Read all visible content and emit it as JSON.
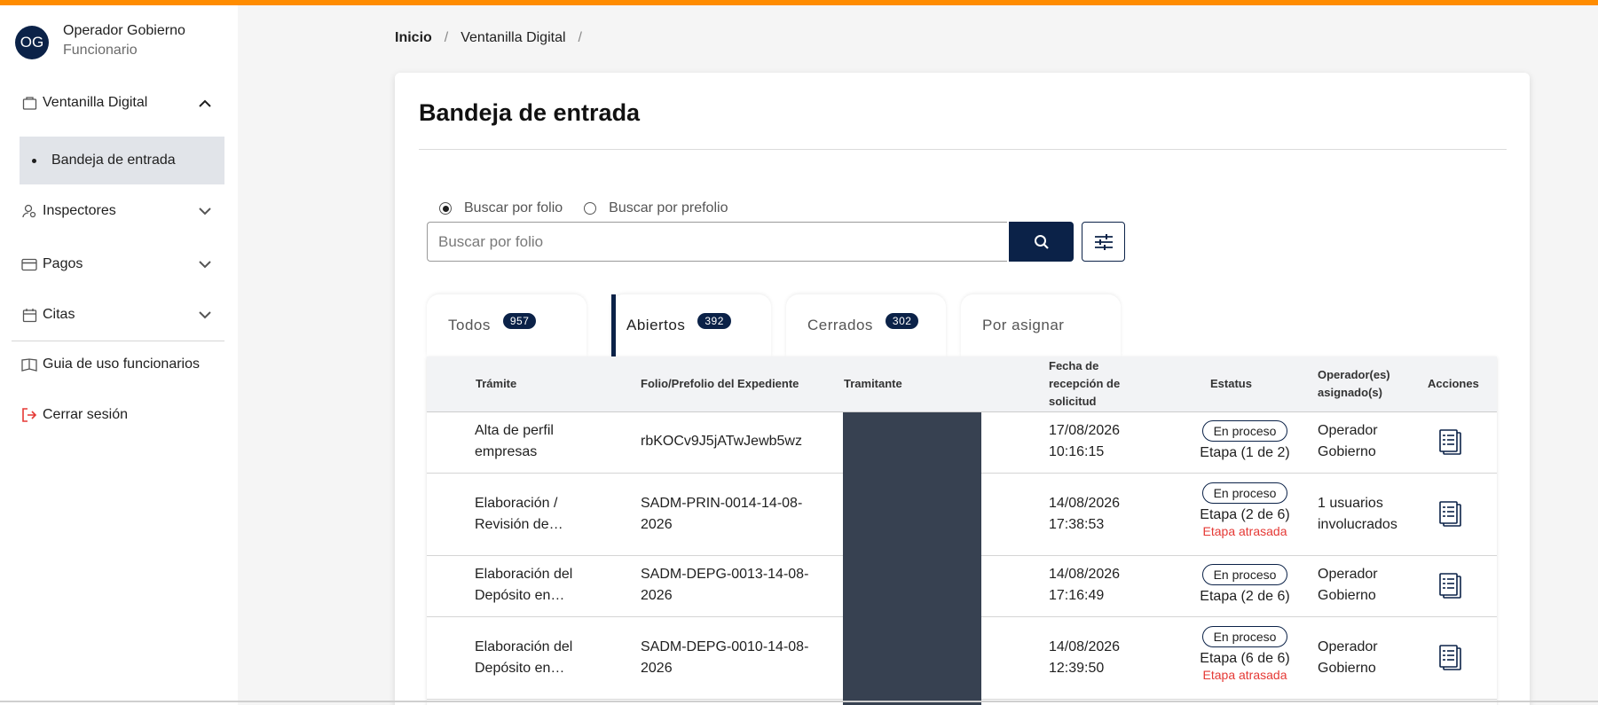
{
  "colors": {
    "accent": "#ff8c00",
    "primary": "#0b2248",
    "late": "#e53935"
  },
  "user": {
    "initials": "OG",
    "name": "Operador Gobierno",
    "role": "Funcionario"
  },
  "sidebar": {
    "items": [
      {
        "label": "Ventanilla Digital",
        "icon": "briefcase-icon",
        "expanded": true
      },
      {
        "label": "Inspectores",
        "icon": "inspector-icon",
        "expanded": false
      },
      {
        "label": "Pagos",
        "icon": "credit-card-icon",
        "expanded": false
      },
      {
        "label": "Citas",
        "icon": "calendar-icon",
        "expanded": false
      },
      {
        "label": "Guia de uso funcionarios",
        "icon": "book-icon"
      },
      {
        "label": "Cerrar sesión",
        "icon": "logout-icon"
      }
    ],
    "sub_item": "Bandeja de entrada"
  },
  "breadcrumb": {
    "home": "Inicio",
    "current": "Ventanilla Digital",
    "sep": "/"
  },
  "main": {
    "title": "Bandeja de entrada",
    "search": {
      "radio_folio": "Buscar por folio",
      "radio_prefolio": "Buscar por prefolio",
      "selected": "folio",
      "placeholder": "Buscar por folio"
    },
    "tabs": [
      {
        "label": "Todos",
        "count": "957"
      },
      {
        "label": "Abiertos",
        "count": "392",
        "active": true
      },
      {
        "label": "Cerrados",
        "count": "302"
      },
      {
        "label": "Por asignar"
      }
    ],
    "table": {
      "headers": {
        "tramite": "Trámite",
        "folio": "Folio/Prefolio del Expediente",
        "tramitante": "Tramitante",
        "fecha_l1": "Fecha de",
        "fecha_l2": "recepción de",
        "fecha_l3": "solicitud",
        "estatus": "Estatus",
        "operador_l1": "Operador(es)",
        "operador_l2": "asignado(s)",
        "acciones": "Acciones"
      },
      "rows": [
        {
          "tramite_l1": "Alta de perfil",
          "tramite_l2": "empresas",
          "folio_l1": "rbKOCv9J5jATwJewb5wz",
          "folio_l2": "",
          "fecha": "17/08/2026",
          "hora": "10:16:15",
          "status": "En proceso",
          "etapa": "Etapa (1 de 2)",
          "late": "",
          "op_l1": "Operador",
          "op_l2": "Gobierno"
        },
        {
          "tramite_l1": "Elaboración /",
          "tramite_l2": "Revisión de…",
          "folio_l1": "SADM-PRIN-0014-14-08-",
          "folio_l2": "2026",
          "fecha": "14/08/2026",
          "hora": "17:38:53",
          "status": "En proceso",
          "etapa": "Etapa (2 de 6)",
          "late": "Etapa atrasada",
          "op_l1": "1 usuarios",
          "op_l2": "involucrados"
        },
        {
          "tramite_l1": "Elaboración del",
          "tramite_l2": "Depósito en…",
          "folio_l1": "SADM-DEPG-0013-14-08-",
          "folio_l2": "2026",
          "fecha": "14/08/2026",
          "hora": "17:16:49",
          "status": "En proceso",
          "etapa": "Etapa (2 de 6)",
          "late": "",
          "op_l1": "Operador",
          "op_l2": "Gobierno"
        },
        {
          "tramite_l1": "Elaboración del",
          "tramite_l2": "Depósito en…",
          "folio_l1": "SADM-DEPG-0010-14-08-",
          "folio_l2": "2026",
          "fecha": "14/08/2026",
          "hora": "12:39:50",
          "status": "En proceso",
          "etapa": "Etapa (6 de 6)",
          "late": "Etapa atrasada",
          "op_l1": "Operador",
          "op_l2": "Gobierno"
        }
      ]
    }
  }
}
